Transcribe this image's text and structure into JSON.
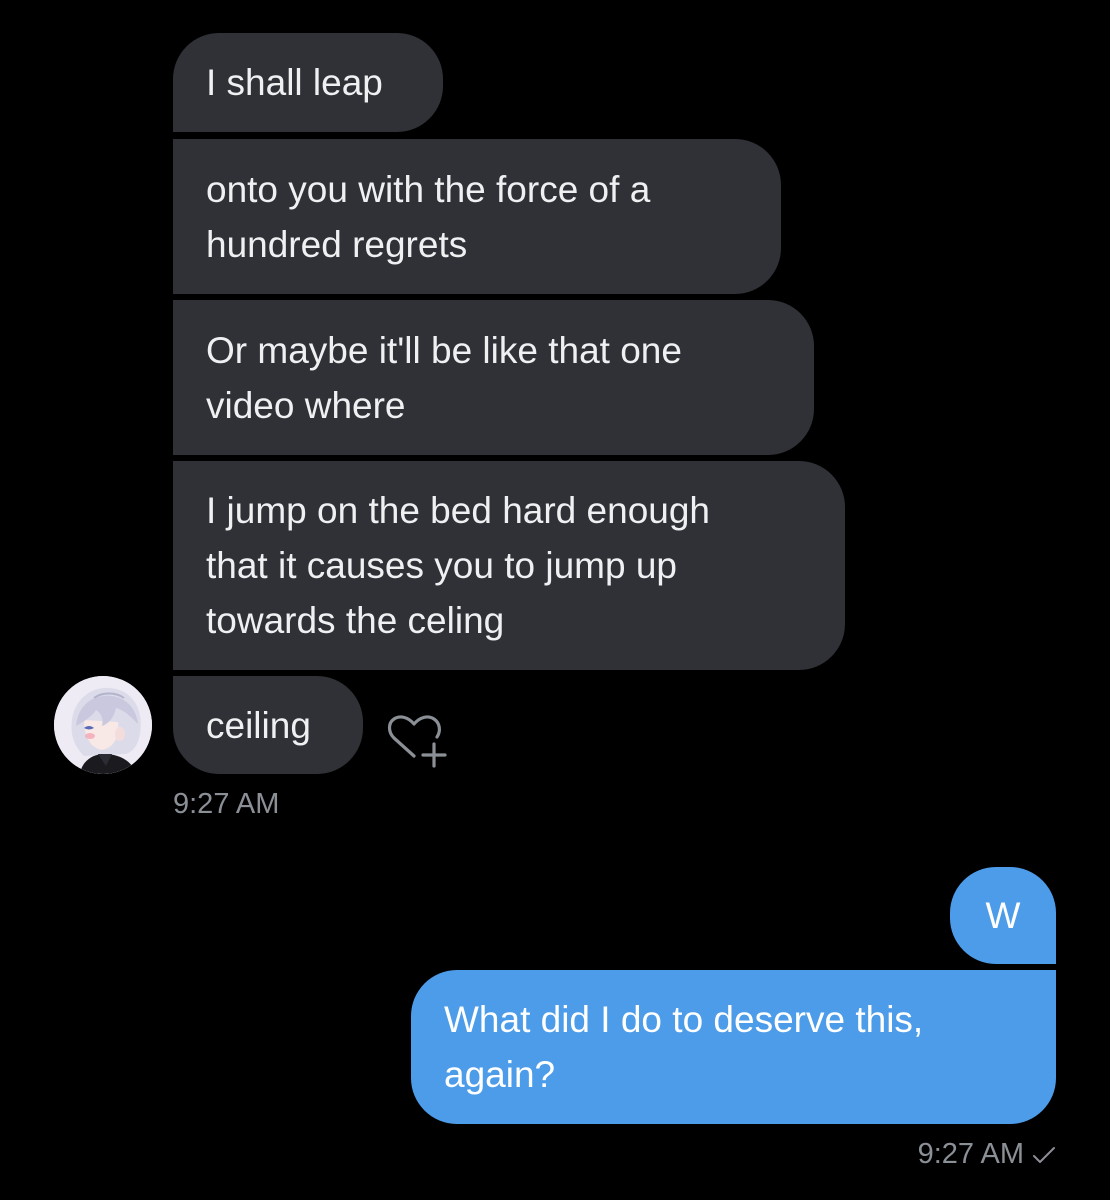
{
  "received": {
    "messages": [
      {
        "lines": [
          "I shall leap"
        ]
      },
      {
        "lines": [
          "onto you with the force of a",
          "hundred regrets"
        ]
      },
      {
        "lines": [
          "Or maybe it'll be like that one",
          "video where"
        ]
      },
      {
        "lines": [
          "I jump on the bed hard enough",
          "that it causes you to jump up",
          "towards the celing"
        ]
      },
      {
        "lines": [
          "ceiling"
        ]
      }
    ],
    "timestamp": "9:27 AM",
    "avatar_icon": "avatar-anime-character",
    "react_icon": "heart-plus-icon"
  },
  "sent": {
    "messages": [
      {
        "lines": [
          "W"
        ]
      },
      {
        "lines": [
          "What did I do to deserve this,",
          "again?"
        ]
      }
    ],
    "timestamp": "9:27 AM",
    "status_icon": "checkmark-icon"
  },
  "colors": {
    "background": "#000000",
    "received_bubble": "#2f3136",
    "sent_bubble": "#4c9ce9",
    "timestamp": "#8b8f96"
  }
}
